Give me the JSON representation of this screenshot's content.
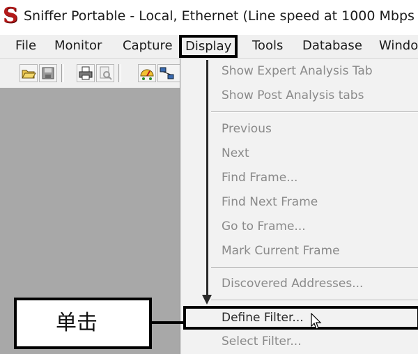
{
  "window": {
    "title": "Sniffer Portable - Local, Ethernet (Line speed at 1000 Mbps",
    "logo_icon": "sniffer-s-logo",
    "logo_color": "#b41a1a"
  },
  "menubar": {
    "items": [
      "File",
      "Monitor",
      "Capture",
      "Display",
      "Tools",
      "Database",
      "Windo"
    ],
    "active": "Display"
  },
  "toolbar": {
    "icons": [
      "open-folder-icon",
      "save-icon",
      "print-icon",
      "print-preview-icon",
      "dashboard-icon",
      "network-icon"
    ]
  },
  "display_menu": {
    "items": [
      "Show Expert Analysis Tab",
      "Show Post Analysis tabs",
      "Previous",
      "Next",
      "Find Frame...",
      "Find Next Frame",
      "Go to Frame...",
      "Mark Current Frame",
      "Discovered Addresses...",
      "Define Filter...",
      "Select Filter..."
    ],
    "highlighted": "Define Filter..."
  },
  "annotation": {
    "callout_text": "单击"
  }
}
